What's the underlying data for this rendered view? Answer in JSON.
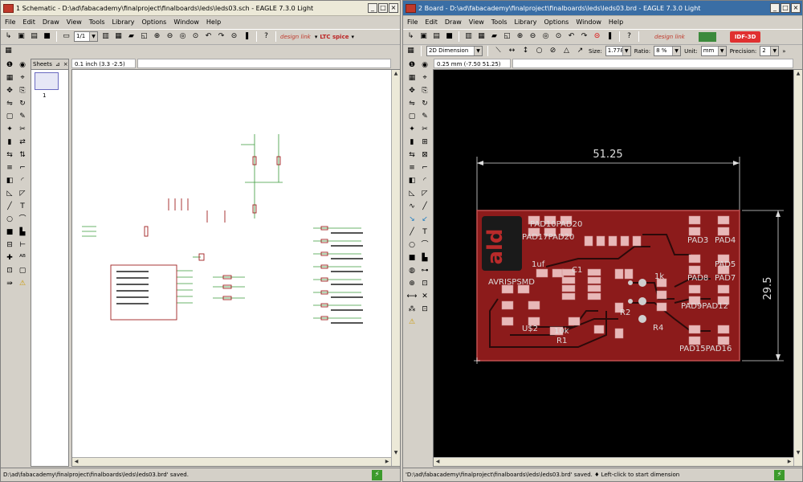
{
  "left": {
    "title": "1 Schematic - D:\\ad\\fabacademy\\finalproject\\finalboards\\leds\\leds03.sch - EAGLE 7.3.0 Light",
    "menu": [
      "File",
      "Edit",
      "Draw",
      "View",
      "Tools",
      "Library",
      "Options",
      "Window",
      "Help"
    ],
    "sheet_combo": "1/1",
    "ltc_label": "LTC spice",
    "designlink_label": "design link",
    "sheets_label": "Sheets",
    "sheet_number": "1",
    "coord_text": "0.1 inch (3.3 -2.5)",
    "status_text": "D:\\ad\\fabacademy\\finalproject\\finalboards\\leds\\leds03.brd' saved."
  },
  "right": {
    "title": "2 Board - D:\\ad\\fabacademy\\finalproject\\finalboards\\leds\\leds03.brd - EAGLE 7.3.0 Light",
    "menu": [
      "File",
      "Edit",
      "Draw",
      "View",
      "Tools",
      "Library",
      "Options",
      "Window",
      "Help"
    ],
    "designlink_label": "design link",
    "idf_label": "IDF-3D",
    "dimension_combo": "2D Dimension",
    "size_label": "Size:",
    "size_value": "1.778",
    "ratio_label": "Ratio:",
    "ratio_value": "8 %",
    "unit_label": "Unit:",
    "unit_value": "mm",
    "precision_label": "Precision:",
    "precision_value": "2",
    "coord_text": "0.25 mm (-7.50 51.25)",
    "status_text": "'D:\\ad\\fabacademy\\finalproject\\finalboards\\leds\\leds03.brd' saved.  ♦ Left-click to start dimension",
    "board": {
      "width_dim": "51.25",
      "height_dim": "29.5",
      "logo": "ald",
      "labels": {
        "pad10pad20": "PAD10PAD20",
        "pad17pad20": "PAD17PAD20",
        "pad3": "PAD3",
        "pad4": "PAD4",
        "pad8": "PAD8",
        "pad7": "PAD7",
        "pad5": "PAD5",
        "pad9pad12": "PAD9PAD12",
        "pad15pad16": "PAD15PAD16",
        "avrisp": "AVRISPSMD",
        "u2": "U$2",
        "c1": "C1",
        "r1": "R1",
        "r4": "R4",
        "r2": "R2",
        "onek": "1k",
        "tenk": "10k",
        "oneuf": "1uf"
      }
    }
  }
}
